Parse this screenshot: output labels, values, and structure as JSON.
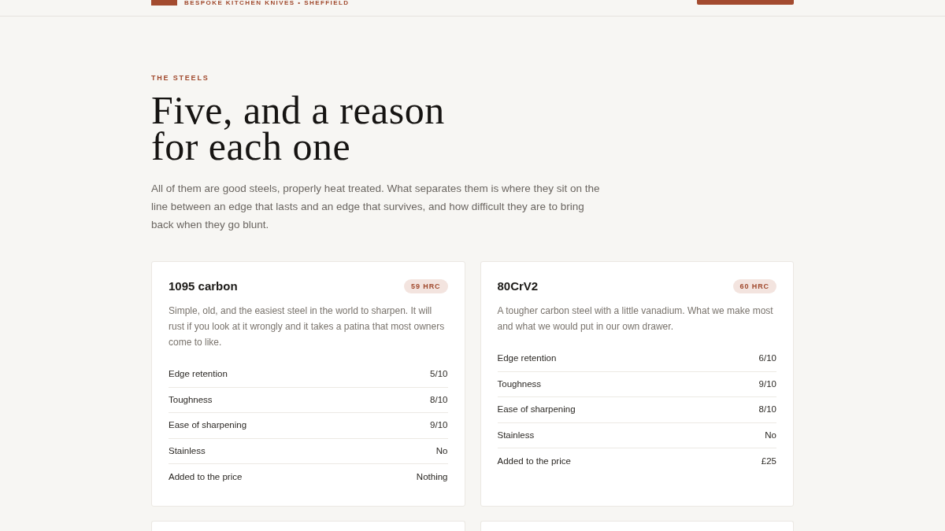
{
  "header": {
    "tagline": "BESPOKE KITCHEN KNIVES • SHEFFIELD"
  },
  "section": {
    "eyebrow": "THE STEELS",
    "heading_lines": [
      "Five, and a reason",
      "for each one"
    ],
    "intro": "All of them are good steels, properly heat treated. What separates them is where they sit on the line between an edge that lasts and an edge that survives, and how difficult they are to bring back when they go blunt."
  },
  "steels": [
    {
      "name": "1095 carbon",
      "hardness": "59 HRC",
      "description": "Simple, old, and the easiest steel in the world to sharpen. It will rust if you look at it wrongly and it takes a patina that most owners come to like.",
      "specs": [
        {
          "label": "Edge retention",
          "value": "5/10"
        },
        {
          "label": "Toughness",
          "value": "8/10"
        },
        {
          "label": "Ease of sharpening",
          "value": "9/10"
        },
        {
          "label": "Stainless",
          "value": "No"
        },
        {
          "label": "Added to the price",
          "value": "Nothing"
        }
      ]
    },
    {
      "name": "80CrV2",
      "hardness": "60 HRC",
      "description": "A tougher carbon steel with a little vanadium. What we make most and what we would put in our own drawer.",
      "specs": [
        {
          "label": "Edge retention",
          "value": "6/10"
        },
        {
          "label": "Toughness",
          "value": "9/10"
        },
        {
          "label": "Ease of sharpening",
          "value": "8/10"
        },
        {
          "label": "Stainless",
          "value": "No"
        },
        {
          "label": "Added to the price",
          "value": "£25"
        }
      ]
    }
  ]
}
